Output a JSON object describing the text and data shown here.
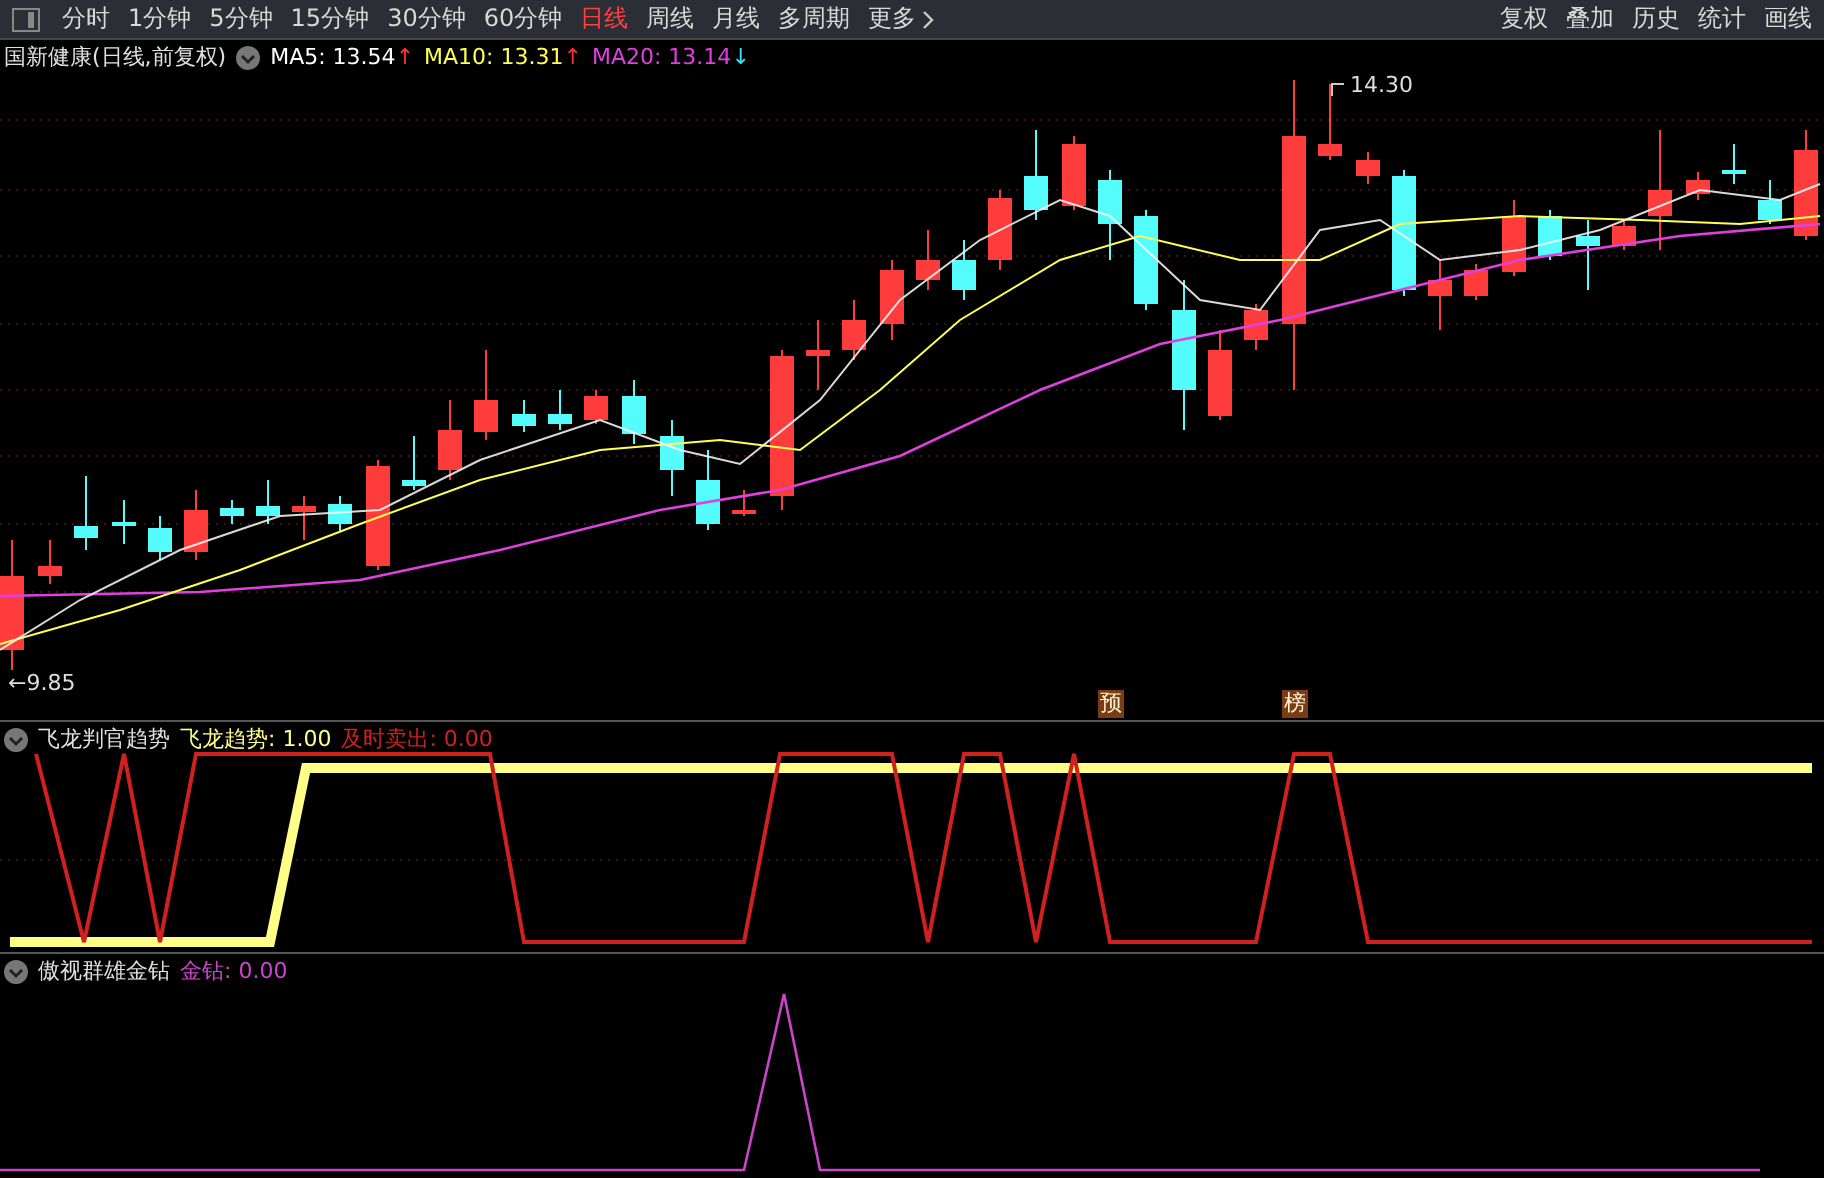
{
  "toolbar": {
    "tabs": [
      {
        "label": "分时",
        "selected": false
      },
      {
        "label": "1分钟",
        "selected": false
      },
      {
        "label": "5分钟",
        "selected": false
      },
      {
        "label": "15分钟",
        "selected": false
      },
      {
        "label": "30分钟",
        "selected": false
      },
      {
        "label": "60分钟",
        "selected": false
      },
      {
        "label": "日线",
        "selected": true
      },
      {
        "label": "周线",
        "selected": false
      },
      {
        "label": "月线",
        "selected": false
      },
      {
        "label": "多周期",
        "selected": false
      },
      {
        "label": "更多",
        "selected": false
      }
    ],
    "right_buttons": [
      "复权",
      "叠加",
      "历史",
      "统计",
      "画线"
    ]
  },
  "main_chart": {
    "title": "国新健康(日线,前复权)",
    "indicators": [
      {
        "label": "MA5: 13.54",
        "arrow": "↑",
        "kind": "up",
        "color": "#ffffff"
      },
      {
        "label": "MA10: 13.31",
        "arrow": "↑",
        "kind": "up",
        "color": "#ffff55"
      },
      {
        "label": "MA20: 13.14",
        "arrow": "↓",
        "kind": "down",
        "color": "#e040e0"
      }
    ],
    "high_label": "14.30",
    "low_label": "←9.85",
    "badges": [
      "预",
      "榜"
    ]
  },
  "panels": [
    {
      "title": "飞龙判官趋势",
      "values": [
        {
          "label": "飞龙趋势: 1.00",
          "color": "#ffff88"
        },
        {
          "label": "及时卖出: 0.00",
          "color": "#d02020"
        }
      ]
    },
    {
      "title": "傲视群雄金钻",
      "values": [
        {
          "label": "金钻: 0.00",
          "color": "#cc44cc"
        }
      ]
    }
  ]
}
